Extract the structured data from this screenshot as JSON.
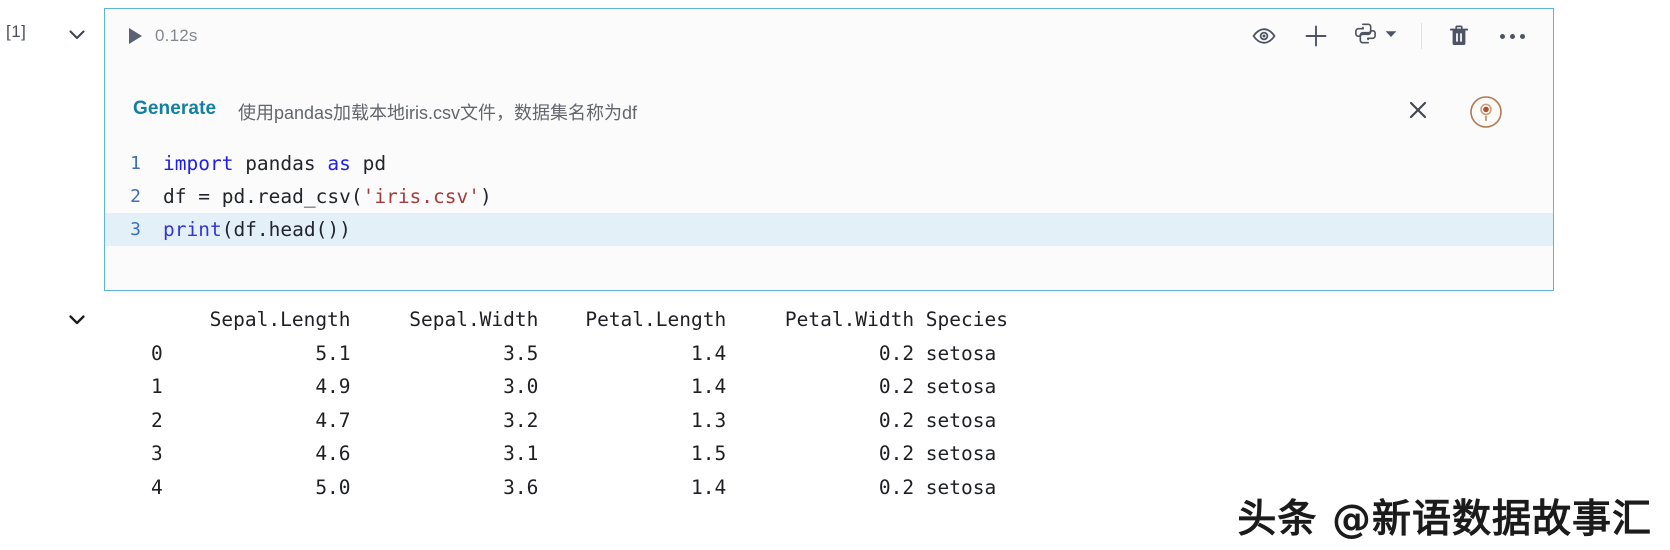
{
  "cell": {
    "execution_count": "[1]",
    "run_duration": "0.12s",
    "collapse_icon": "chevron-down-icon",
    "play_icon": "play-triangle-icon",
    "border_color": "#5fb4d8",
    "background": "#fbfbfb"
  },
  "toolbar": {
    "items": [
      {
        "name": "preview-eye-icon",
        "label": ""
      },
      {
        "name": "add-cell-icon",
        "label": ""
      },
      {
        "name": "python-kernel-icon",
        "label": ""
      },
      {
        "name": "kernel-dropdown-chevron-icon",
        "label": ""
      },
      {
        "name": "delete-cell-trash-icon",
        "label": ""
      },
      {
        "name": "more-actions-icon",
        "label": ""
      }
    ]
  },
  "generate": {
    "label": "Generate",
    "prompt": "使用pandas加载本地iris.csv文件，数据集名称为df",
    "label_color": "#127fa3",
    "close_icon": "close-x-icon",
    "copilot_icon": "copilot-circle-icon",
    "copilot_color": "#a9673f"
  },
  "code": {
    "lines": [
      {
        "number": "1",
        "active": false,
        "tokens": [
          {
            "t": "import",
            "c": "kw"
          },
          {
            "t": " pandas ",
            "c": "plain"
          },
          {
            "t": "as",
            "c": "kw"
          },
          {
            "t": " pd",
            "c": "plain"
          }
        ]
      },
      {
        "number": "2",
        "active": false,
        "tokens": [
          {
            "t": "df = pd.read_csv(",
            "c": "plain"
          },
          {
            "t": "'iris.csv'",
            "c": "str"
          },
          {
            "t": ")",
            "c": "plain"
          }
        ]
      },
      {
        "number": "3",
        "active": true,
        "tokens": [
          {
            "t": "print",
            "c": "fn"
          },
          {
            "t": "(df.head())",
            "c": "plain"
          }
        ]
      }
    ]
  },
  "output": {
    "collapse_icon": "chevron-down-icon",
    "columns": [
      "Sepal.Length",
      "Sepal.Width",
      "Petal.Length",
      "Petal.Width",
      "Species"
    ],
    "rows": [
      {
        "index": "0",
        "values": [
          "5.1",
          "3.5",
          "1.4",
          "0.2",
          "setosa"
        ]
      },
      {
        "index": "1",
        "values": [
          "4.9",
          "3.0",
          "1.4",
          "0.2",
          "setosa"
        ]
      },
      {
        "index": "2",
        "values": [
          "4.7",
          "3.2",
          "1.3",
          "0.2",
          "setosa"
        ]
      },
      {
        "index": "3",
        "values": [
          "4.6",
          "3.1",
          "1.5",
          "0.2",
          "setosa"
        ]
      },
      {
        "index": "4",
        "values": [
          "5.0",
          "3.6",
          "1.4",
          "0.2",
          "setosa"
        ]
      }
    ]
  },
  "watermark": {
    "text": "头条 @新语数据故事汇"
  }
}
